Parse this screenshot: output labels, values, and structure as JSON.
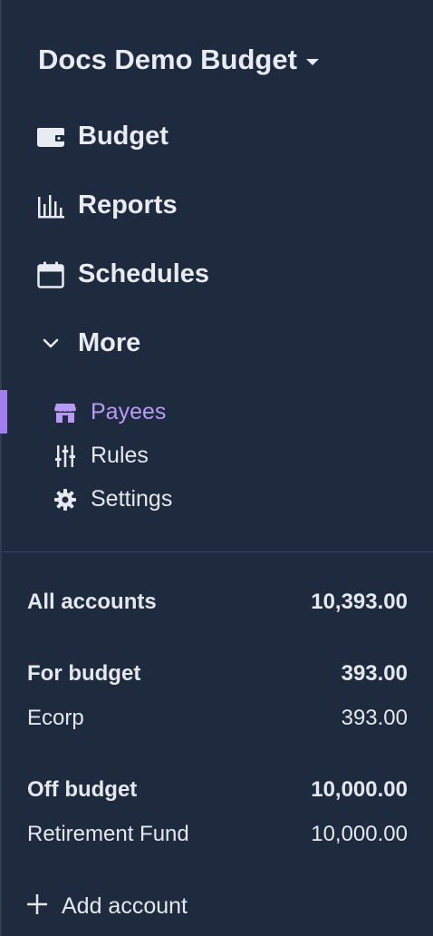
{
  "header": {
    "budget_name": "Docs Demo Budget"
  },
  "nav": {
    "budget": "Budget",
    "reports": "Reports",
    "schedules": "Schedules",
    "more": "More"
  },
  "more_items": {
    "payees": "Payees",
    "rules": "Rules",
    "settings": "Settings"
  },
  "accounts": {
    "all": {
      "label": "All accounts",
      "amount": "10,393.00"
    },
    "for_budget": {
      "label": "For budget",
      "amount": "393.00"
    },
    "ecorp": {
      "label": "Ecorp",
      "amount": "393.00"
    },
    "off_budget": {
      "label": "Off budget",
      "amount": "10,000.00"
    },
    "retirement": {
      "label": "Retirement Fund",
      "amount": "10,000.00"
    }
  },
  "add_account": "Add account",
  "colors": {
    "background": "#1e2a3e",
    "accent": "#a37df0",
    "text": "#e4e8ee"
  },
  "icons": {
    "budget": "wallet-icon",
    "reports": "bar-chart-icon",
    "schedules": "calendar-icon",
    "more": "chevron-down-icon",
    "payees": "store-icon",
    "rules": "sliders-icon",
    "settings": "gear-icon",
    "add": "plus-icon"
  }
}
